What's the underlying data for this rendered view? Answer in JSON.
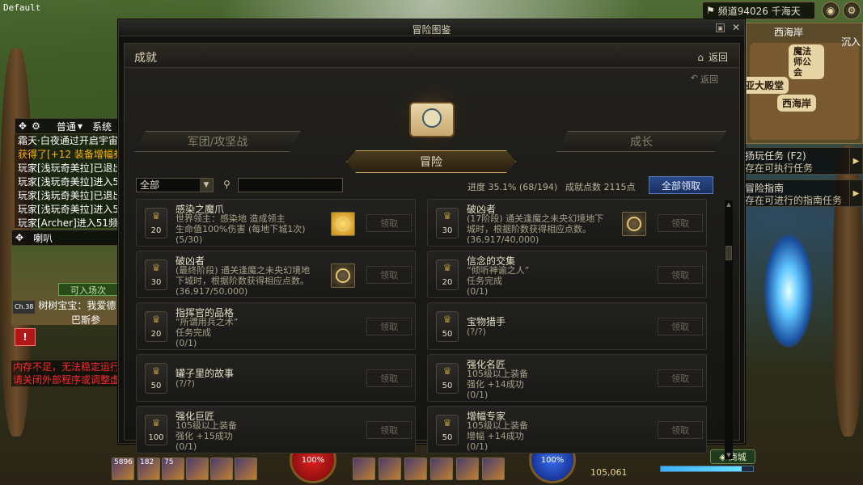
{
  "screen": {
    "default_label": "Default",
    "channel": "频道94026 千海天",
    "minimap": {
      "title": "西海岸",
      "sub": "沉入",
      "place1": "魔法师公会",
      "place2": "亚大殿堂",
      "place3": "西海岸"
    },
    "tasks": [
      {
        "title": "扬玩任务 (F2)",
        "desc": "存在可执行任务"
      },
      {
        "title": "冒险指南",
        "desc": "存在可进行的指南任务"
      }
    ]
  },
  "chat": {
    "tab_normal": "普通",
    "tab_system": "系统",
    "lines": [
      {
        "text": "霜天·白夜通过开启宇宙",
        "cls": ""
      },
      {
        "text": "获得了[+12 装备增幅券]",
        "cls": "y"
      },
      {
        "text": "玩家[浅玩奇美拉]已退出",
        "cls": ""
      },
      {
        "text": "玩家[浅玩奇美拉]进入5",
        "cls": ""
      },
      {
        "text": "玩家[浅玩奇美拉]已退出",
        "cls": ""
      },
      {
        "text": "玩家[浅玩奇美拉]进入5",
        "cls": ""
      },
      {
        "text": "玩家[Archer]进入51频",
        "cls": ""
      }
    ],
    "horn_tab": "喇叭",
    "banner": "可入场次",
    "bottom_channel": "Ch.38",
    "bottom_line": "树树宝宝：我爱德",
    "bottom_line2": "巴斯参"
  },
  "warning": {
    "line1": "内存不足，无法稳定运行",
    "line2": "请关闭外部程序或调整虚"
  },
  "hud": {
    "skill1": "5896",
    "skill2": "182",
    "skill3": "75",
    "hp": "100%",
    "mp": "100%",
    "gold": "105,061",
    "town": "商城",
    "exp_fraction": 0.88
  },
  "window": {
    "title": "冒险图鉴",
    "section": "成就",
    "back_top": "返回",
    "back_sub": "返回",
    "tab_left": "军团/攻坚战",
    "tab_center": "冒险",
    "tab_right": "成长",
    "filter": "全部",
    "search_placeholder": "",
    "progress": "进度  35.1% (68/194)",
    "points": "成就点数  2115点",
    "claim_all": "全部领取",
    "claim": "领取"
  },
  "achievements": [
    {
      "title": "感染之魔爪",
      "level": "20",
      "lines": [
        "世界领主：感染地      造成领主",
        "生命值100%伤害 (每地下城1次)"
      ],
      "progress": "(5/30)",
      "reward": "gold"
    },
    {
      "title": "破凶者",
      "level": "30",
      "lines": [
        "(17阶段) 通关逢魔之未央幻境地下",
        "城时，根据阶数获得相应点数。"
      ],
      "progress": "(36,917/40,000)",
      "reward": "dark"
    },
    {
      "title": "破凶者",
      "level": "30",
      "lines": [
        "(最终阶段) 通关逢魔之未央幻境地",
        "下城时，根据阶数获得相应点数。"
      ],
      "progress": "(36,917/50,000)",
      "reward": "dark"
    },
    {
      "title": "信念的交集",
      "level": "20",
      "lines": [
        "“倾听神谕之人”",
        "任务完成"
      ],
      "progress": "(0/1)",
      "reward": ""
    },
    {
      "title": "指挥官的品格",
      "level": "20",
      "lines": [
        "“所谓用兵之术”",
        "任务完成"
      ],
      "progress": "(0/1)",
      "reward": ""
    },
    {
      "title": "宝物猎手",
      "level": "50",
      "lines": [],
      "progress": "(?/?)",
      "reward": ""
    },
    {
      "title": "罐子里的故事",
      "level": "50",
      "lines": [],
      "progress": "(?/?)",
      "reward": ""
    },
    {
      "title": "强化名匠",
      "level": "50",
      "lines": [
        "105级以上装备",
        "强化 +14成功"
      ],
      "progress": "(0/1)",
      "reward": ""
    },
    {
      "title": "强化巨匠",
      "level": "100",
      "lines": [
        "105级以上装备",
        "强化 +15成功"
      ],
      "progress": "(0/1)",
      "reward": ""
    },
    {
      "title": "增幅专家",
      "level": "50",
      "lines": [
        "105级以上装备",
        "增幅 +14成功"
      ],
      "progress": "(0/1)",
      "reward": ""
    }
  ]
}
